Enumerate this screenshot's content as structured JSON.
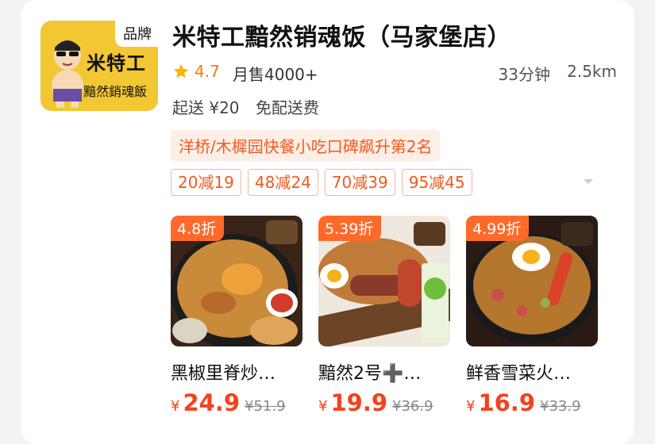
{
  "store": {
    "badge": "品牌",
    "logo_text_1": "米特工",
    "logo_text_2": "黯然銷魂飯",
    "name": "米特工黯然销魂饭（马家堡店）",
    "rating": "4.7",
    "monthly_sales": "月售4000+",
    "delivery_time": "33分钟",
    "distance": "2.5km",
    "min_order": "起送 ¥20",
    "delivery_fee": "免配送费",
    "rank_label": "洋桥/木樨园快餐小吃口碑飙升第2名"
  },
  "coupons": [
    "20减19",
    "48减24",
    "70减39",
    "95减45"
  ],
  "items": [
    {
      "discount": "4.8折",
      "name": "黑椒里脊炒…",
      "currency": "¥",
      "price": "24.9",
      "original": "¥51.9"
    },
    {
      "discount": "5.39折",
      "name": "黯然2号➕…",
      "currency": "¥",
      "price": "19.9",
      "original": "¥36.9"
    },
    {
      "discount": "4.99折",
      "name": "鲜香雪菜火…",
      "currency": "¥",
      "price": "16.9",
      "original": "¥33.9"
    }
  ],
  "colors": {
    "accent": "#f5411d",
    "rating": "#ff7a00",
    "logo_bg": "#f2c733",
    "discount_tag": "#ff6a2b"
  },
  "icons": [
    "star-icon",
    "chevron-down-icon"
  ]
}
